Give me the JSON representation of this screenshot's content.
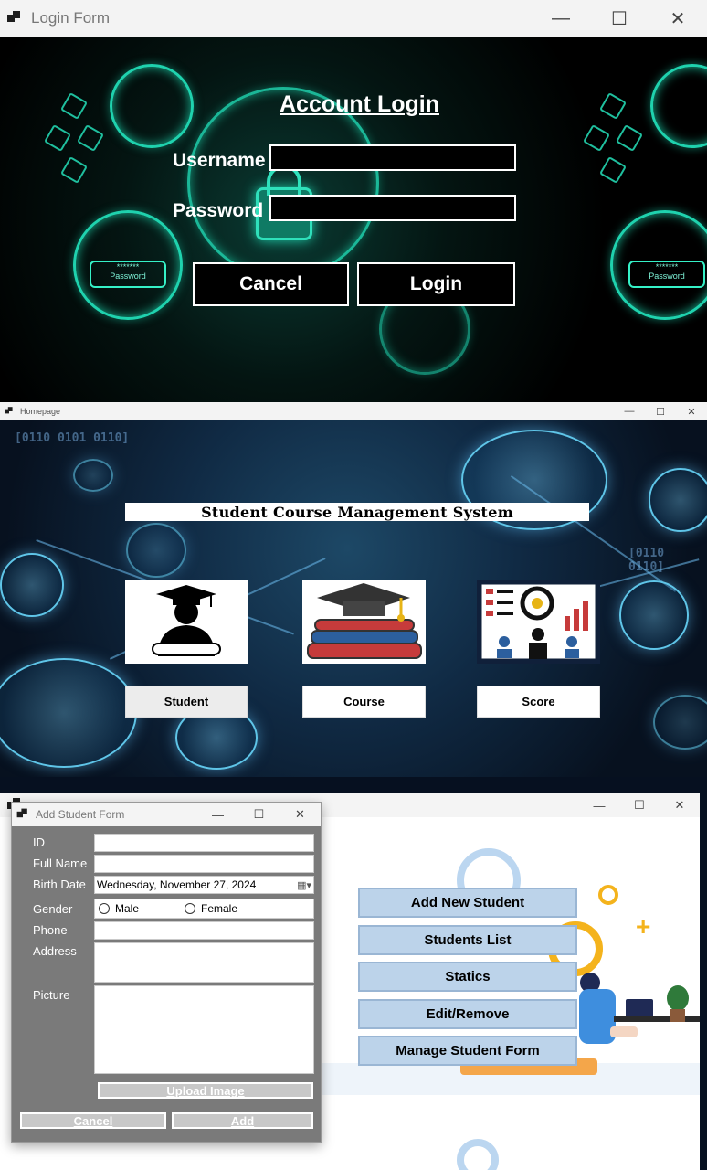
{
  "login_window": {
    "title": "Login Form",
    "heading": "Account Login",
    "username_label": "Username",
    "password_label": "Password",
    "username_value": "",
    "password_value": "",
    "cancel_label": "Cancel",
    "login_label": "Login",
    "badge_dots": "*******",
    "badge_text": "Password",
    "icon": "fingerprint-lock-icon"
  },
  "home_window": {
    "title": "Homepage",
    "system_title": "Student Course Management System",
    "binary_left": "[0110 0101 0110]",
    "binary_right": "[0110 0110]",
    "tiles": [
      {
        "label": "Student",
        "icon": "graduate-icon"
      },
      {
        "label": "Course",
        "icon": "books-mortarboard-icon"
      },
      {
        "label": "Score",
        "icon": "presentation-gear-icon"
      }
    ]
  },
  "manage_window": {
    "buttons": [
      "Add New Student",
      "Students List",
      "Statics",
      "Edit/Remove",
      "Manage Student Form"
    ]
  },
  "add_student_form": {
    "title": "Add Student Form",
    "labels": {
      "id": "ID",
      "full_name": "Full Name",
      "birth_date": "Birth Date",
      "gender": "Gender",
      "phone": "Phone",
      "address": "Address",
      "picture": "Picture"
    },
    "values": {
      "id": "",
      "full_name": "",
      "birth_date": "Wednesday, November 27, 2024",
      "phone": "",
      "address": ""
    },
    "gender_options": [
      "Male",
      "Female"
    ],
    "upload_label": "Upload Image",
    "cancel_label": "Cancel",
    "add_label": "Add"
  },
  "colors": {
    "login_accent": "#1fd2ae",
    "home_bg": "#102a44",
    "mgmt_button": "#bcd3ea",
    "form_bg": "#7a7a7a"
  }
}
